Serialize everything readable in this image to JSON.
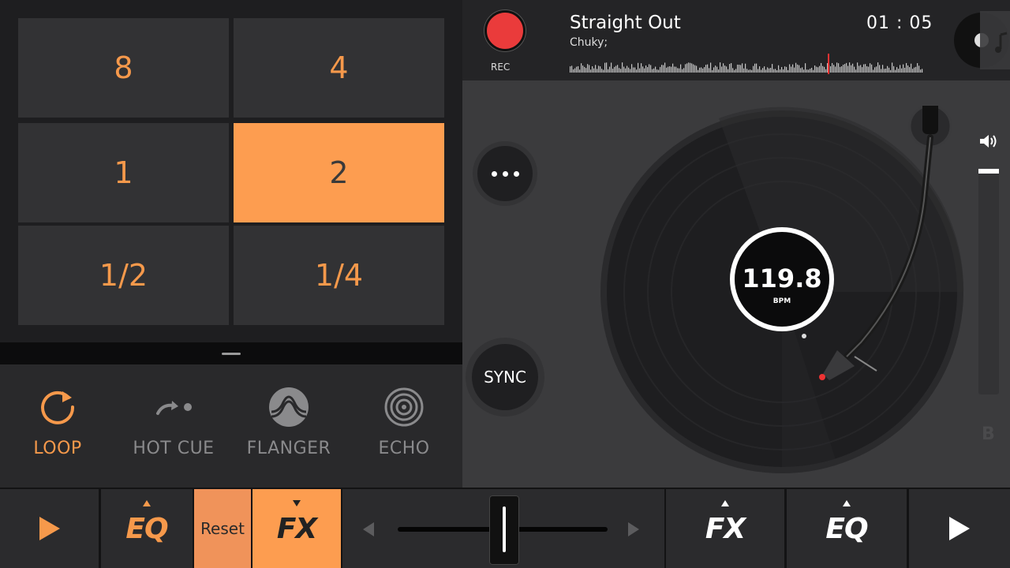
{
  "loop_pads": [
    {
      "label": "8",
      "active": false
    },
    {
      "label": "4",
      "active": false
    },
    {
      "label": "1",
      "active": false
    },
    {
      "label": "2",
      "active": true
    },
    {
      "label": "1/2",
      "active": false
    },
    {
      "label": "1/4",
      "active": false
    }
  ],
  "fx_modes": [
    {
      "label": "LOOP",
      "icon": "loop-icon",
      "active": true
    },
    {
      "label": "HOT CUE",
      "icon": "hot-cue-icon",
      "active": false
    },
    {
      "label": "FLANGER",
      "icon": "flanger-icon",
      "active": false
    },
    {
      "label": "ECHO",
      "icon": "echo-icon",
      "active": false
    }
  ],
  "deck": {
    "rec_label": "REC",
    "track_title": "Straight Out",
    "track_artist": "Chuky;",
    "track_time": "01 : 05",
    "bpm_value": "119.8",
    "bpm_label": "BPM",
    "sync_label": "SYNC",
    "deck_letter": "B",
    "volume_level": 0.99,
    "playhead_fraction": 0.73
  },
  "bottom_bar": {
    "eq_a_label": "EQ",
    "reset_label": "Reset",
    "fx_a_label": "FX",
    "fx_b_label": "FX",
    "eq_b_label": "EQ",
    "crossfader_position": 0.5
  },
  "colors": {
    "accent": "#fd9d50",
    "accent_text": "#f6994b",
    "rec": "#ea3b3b",
    "panel": "#323234",
    "background": "#1b1b1d"
  }
}
